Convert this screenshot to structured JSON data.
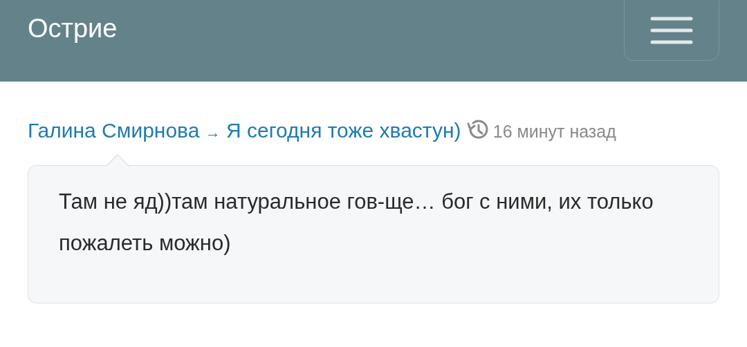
{
  "header": {
    "title": "Острие"
  },
  "comment": {
    "author": "Галина Смирнова",
    "arrow": "→",
    "post": "Я сегодня тоже хвастун)",
    "time": "16 минут назад",
    "text": "Там не яд))там натуральное гов-ще… бог с ними, их только пожалеть можно)"
  }
}
